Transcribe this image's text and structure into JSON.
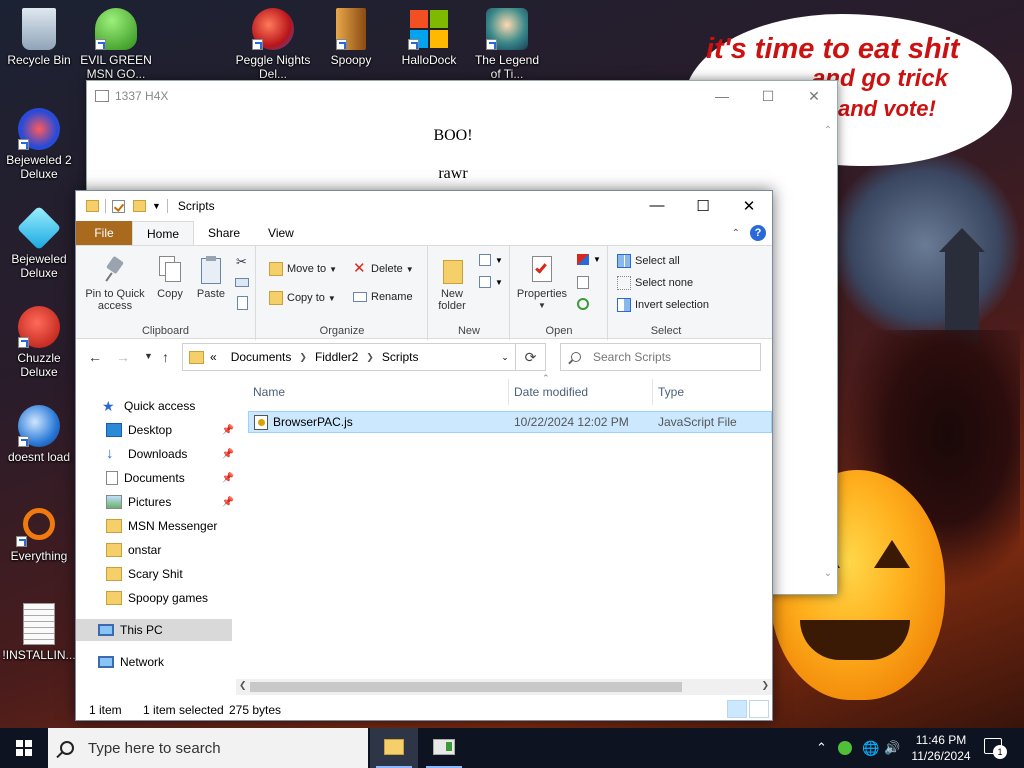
{
  "wallpaper": {
    "text_line1": "it's time to eat shit",
    "text_line2": "and go trick",
    "text_line3": "and vote!",
    "colors": {
      "text": "#cc1111",
      "pumpkin": "#ffb01e"
    }
  },
  "desktop_icons": [
    {
      "label": "Recycle Bin",
      "icon": "recycle-bin-icon",
      "color": "#9fb4c8"
    },
    {
      "label": "EVIL GREEN MSN GO...",
      "icon": "msn-buddy-icon",
      "color": "#4fbf3a"
    },
    {
      "label": "Peggle Nights Del...",
      "icon": "peggle-icon",
      "color": "#d8322a"
    },
    {
      "label": "Spoopy",
      "icon": "spoopy-icon",
      "color": "#c97a2a"
    },
    {
      "label": "HalloDock",
      "icon": "windows-logo-icon",
      "color": "#2a6ad8"
    },
    {
      "label": "The Legend of Ti...",
      "icon": "game-character-icon",
      "color": "#3aa0a0"
    },
    {
      "label": "Bejeweled 2 Deluxe",
      "icon": "bejeweled-2-icon",
      "color": "#2a4ad8"
    },
    {
      "label": "Bejeweled Deluxe",
      "icon": "diamond-icon",
      "color": "#35c6f0"
    },
    {
      "label": "Chuzzle Deluxe",
      "icon": "chuzzle-icon",
      "color": "#d8281c"
    },
    {
      "label": "doesnt load",
      "icon": "thunderbird-icon",
      "color": "#2a7ad8"
    },
    {
      "label": "Everything",
      "icon": "magnifier-icon",
      "color": "#f07a10"
    },
    {
      "label": "!INSTALLIN...",
      "icon": "text-document-icon",
      "color": "#f4f4f4"
    }
  ],
  "back_window": {
    "title": "1337 H4X",
    "line1": "BOO!",
    "line2": "rawr"
  },
  "explorer": {
    "title": "Scripts",
    "tabs": [
      {
        "label": "File"
      },
      {
        "label": "Home"
      },
      {
        "label": "Share"
      },
      {
        "label": "View"
      }
    ],
    "help": "?",
    "ribbon": {
      "clipboard": {
        "label": "Clipboard",
        "pin": "Pin to Quick access",
        "copy": "Copy",
        "paste": "Paste"
      },
      "organize": {
        "label": "Organize",
        "move_to": "Move to",
        "copy_to": "Copy to",
        "delete": "Delete",
        "rename": "Rename"
      },
      "new": {
        "label": "New",
        "new_folder": "New folder"
      },
      "open": {
        "label": "Open",
        "properties": "Properties"
      },
      "select": {
        "label": "Select",
        "select_all": "Select all",
        "select_none": "Select none",
        "invert": "Invert selection"
      }
    },
    "address": {
      "overflow": "«",
      "crumbs": [
        "Documents",
        "Fiddler2",
        "Scripts"
      ]
    },
    "search_placeholder": "Search Scripts",
    "nav": {
      "quick_access": "Quick access",
      "items": [
        {
          "label": "Desktop",
          "pinned": true
        },
        {
          "label": "Downloads",
          "pinned": true
        },
        {
          "label": "Documents",
          "pinned": true
        },
        {
          "label": "Pictures",
          "pinned": true
        },
        {
          "label": "MSN Messenger",
          "pinned": false
        },
        {
          "label": "onstar",
          "pinned": false
        },
        {
          "label": "Scary Shit",
          "pinned": false
        },
        {
          "label": "Spoopy games",
          "pinned": false
        }
      ],
      "this_pc": "This PC",
      "network": "Network"
    },
    "columns": {
      "name": "Name",
      "date": "Date modified",
      "type": "Type"
    },
    "files": [
      {
        "name": "BrowserPAC.js",
        "date": "10/22/2024 12:02 PM",
        "type": "JavaScript File"
      }
    ],
    "status": {
      "count": "1 item",
      "selected": "1 item selected",
      "size": "275 bytes"
    }
  },
  "taskbar": {
    "search_placeholder": "Type here to search",
    "time": "11:46 PM",
    "date": "11/26/2024",
    "notifications": "1",
    "colors": {
      "bg": "#0d1320",
      "accent": "#8cb8ff"
    }
  }
}
